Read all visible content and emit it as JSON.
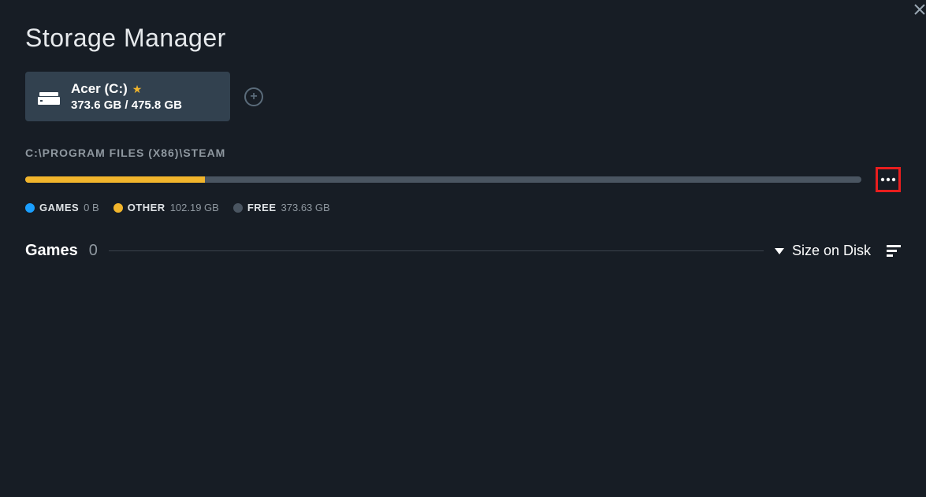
{
  "title": "Storage Manager",
  "drive": {
    "name": "Acer (C:)",
    "starred": true,
    "used": "373.6 GB",
    "sep": " / ",
    "total": "475.8 GB"
  },
  "path": "C:\\PROGRAM FILES (X86)\\STEAM",
  "usage": {
    "games_pct": 0,
    "other_pct": 21.5
  },
  "legend": {
    "games_label": "GAMES",
    "games_value": "0 B",
    "other_label": "OTHER",
    "other_value": "102.19 GB",
    "free_label": "FREE",
    "free_value": "373.63 GB"
  },
  "games": {
    "heading": "Games",
    "count": "0",
    "sort_label": "Size on Disk"
  }
}
